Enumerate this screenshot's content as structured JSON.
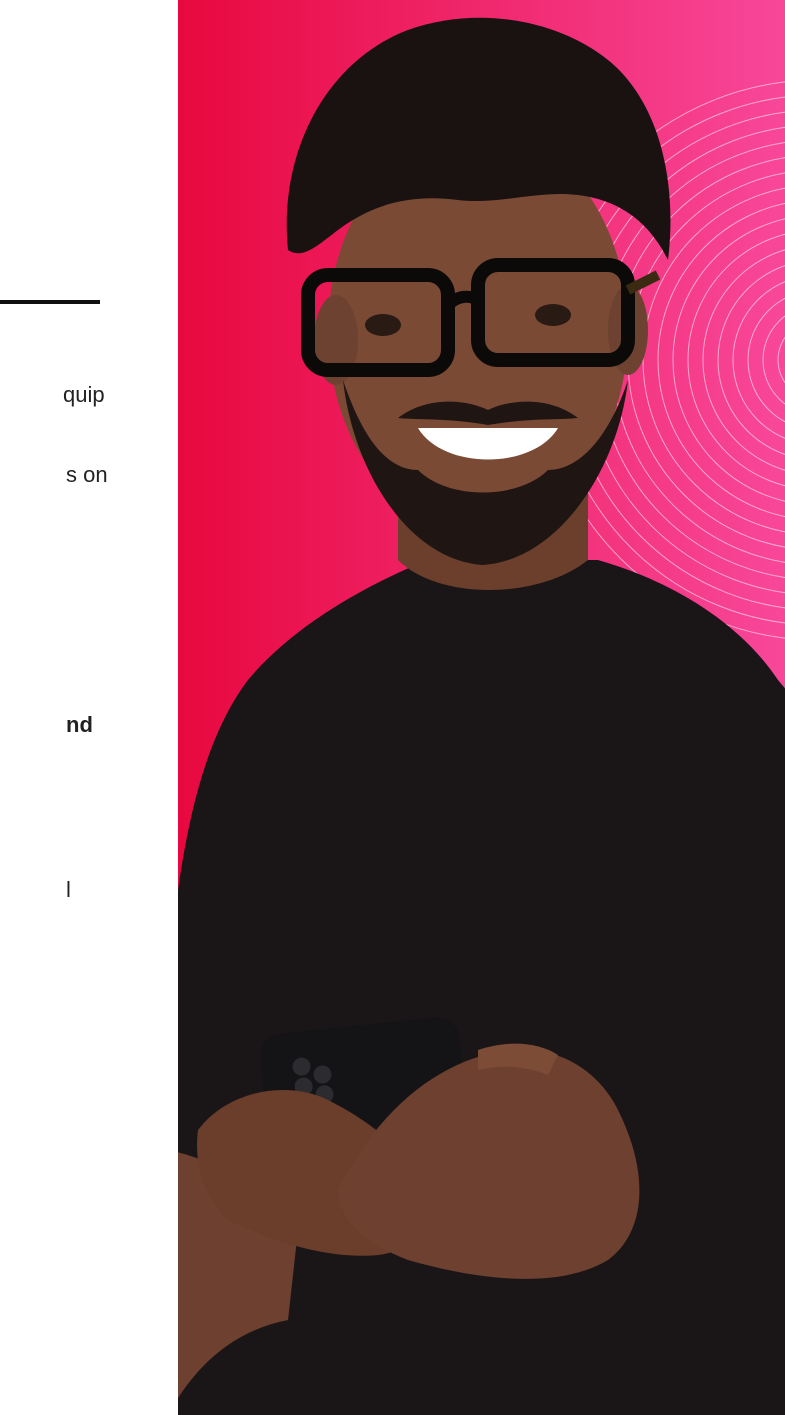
{
  "left_column": {
    "fragments": [
      "quip",
      "s on",
      "nd",
      "l"
    ]
  },
  "hero": {
    "image_description_icon": "person-photo",
    "colors": {
      "gradient_start": "#e8083f",
      "gradient_end": "#f8479a",
      "shirt": "#1a1618",
      "skin": "#7a4a35",
      "hair": "#1a1210",
      "phone": "#141416",
      "rings": "#ffffff"
    }
  }
}
